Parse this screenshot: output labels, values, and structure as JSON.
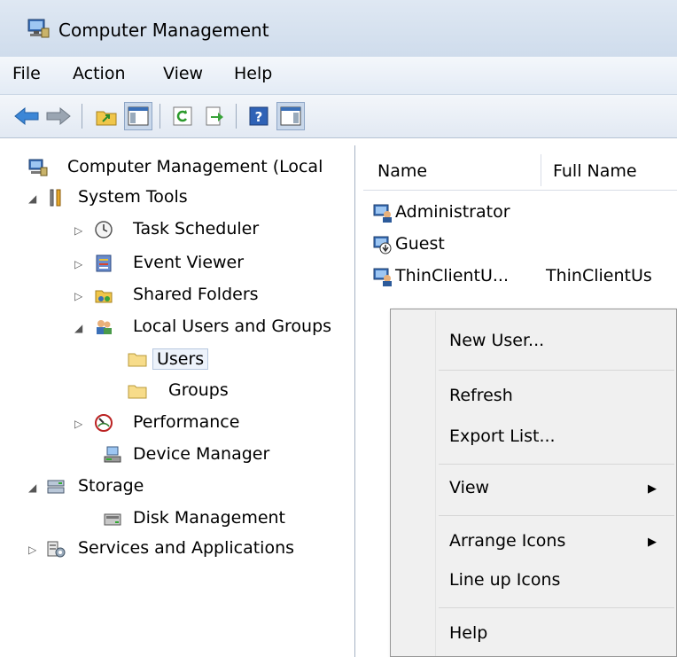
{
  "window": {
    "title": "Computer Management"
  },
  "menubar": [
    {
      "label": "File"
    },
    {
      "label": "Action"
    },
    {
      "label": "View"
    },
    {
      "label": "Help"
    }
  ],
  "toolbar": {
    "icons": [
      "back-arrow-icon",
      "forward-arrow-icon",
      "up-folder-icon",
      "show-hide-console-tree-icon",
      "refresh-icon",
      "export-list-icon",
      "help-icon",
      "show-hide-action-pane-icon"
    ]
  },
  "tree": {
    "items": [
      {
        "label": "Computer Management (Local"
      },
      {
        "label": "System Tools"
      },
      {
        "label": "Task Scheduler"
      },
      {
        "label": "Event Viewer"
      },
      {
        "label": "Shared Folders"
      },
      {
        "label": "Local Users and Groups"
      },
      {
        "label": "Users",
        "selected": true
      },
      {
        "label": "Groups"
      },
      {
        "label": "Performance"
      },
      {
        "label": "Device Manager"
      },
      {
        "label": "Storage"
      },
      {
        "label": "Disk Management"
      },
      {
        "label": "Services and Applications"
      }
    ]
  },
  "list": {
    "columns": [
      "Name",
      "Full Name"
    ],
    "rows": [
      {
        "name": "Administrator",
        "full_name": ""
      },
      {
        "name": "Guest",
        "full_name": ""
      },
      {
        "name": "ThinClientU...",
        "full_name": "ThinClientUs"
      }
    ]
  },
  "context_menu": {
    "items": [
      {
        "label": "New User..."
      },
      {
        "label": "Refresh"
      },
      {
        "label": "Export List..."
      },
      {
        "label": "View",
        "submenu": true
      },
      {
        "label": "Arrange Icons",
        "submenu": true
      },
      {
        "label": "Line up Icons"
      },
      {
        "label": "Help"
      }
    ],
    "submenu_arrow": "▶"
  },
  "colors": {
    "titlebar": "#cfdcec",
    "selection": "#edf3fb",
    "menu_bg": "#f0f0f0"
  }
}
